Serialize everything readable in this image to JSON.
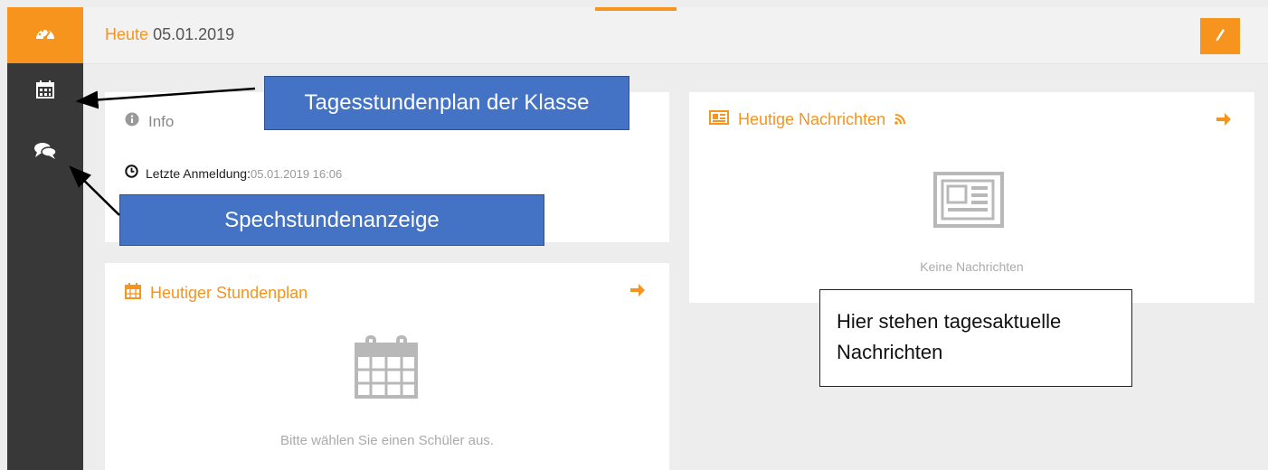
{
  "header": {
    "today_label": "Heute",
    "date": "05.01.2019"
  },
  "info_card": {
    "title": "Info",
    "last_login_label": "Letzte Anmeldung:",
    "last_login_value": "05.01.2019 16:06"
  },
  "news_card": {
    "title": "Heutige Nachrichten",
    "empty_text": "Keine Nachrichten"
  },
  "schedule_card": {
    "title": "Heutiger Stundenplan",
    "empty_text": "Bitte wählen Sie einen Schüler aus."
  },
  "annotations": {
    "schedule_callout": "Tagesstundenplan der Klasse",
    "consult_callout": "Spechstundenanzeige",
    "news_note_line1": "Hier stehen tagesaktuelle",
    "news_note_line2": "Nachrichten"
  },
  "colors": {
    "accent": "#f7941d",
    "sidebar": "#383838",
    "callout": "#4472c4"
  },
  "icons": {
    "dashboard": "dashboard-icon",
    "calendar": "calendar-icon",
    "chat": "chat-icon",
    "edit": "pencil-icon",
    "info": "info-icon",
    "clock": "clock-icon",
    "newspaper": "newspaper-icon",
    "rss": "rss-icon",
    "arrow": "arrow-right-icon"
  }
}
